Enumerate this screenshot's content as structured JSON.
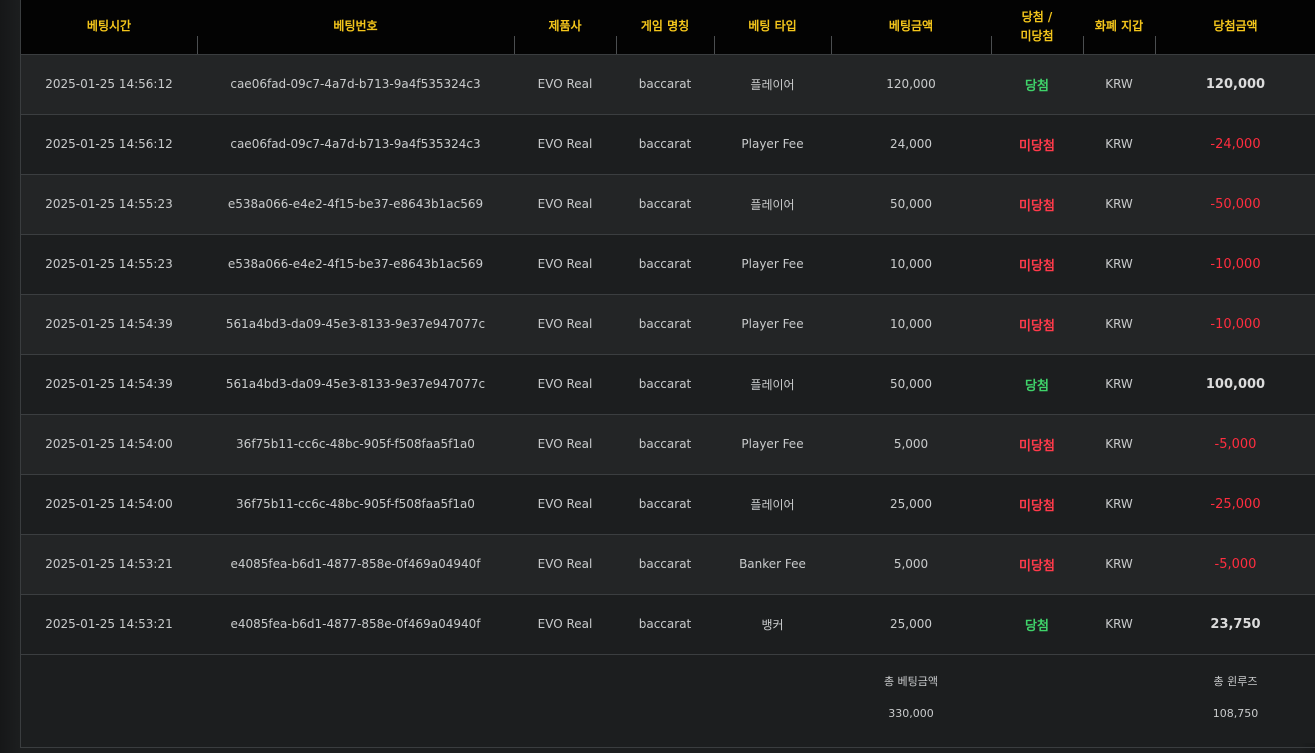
{
  "headers": {
    "bet_time": "베팅시간",
    "bet_id": "베팅번호",
    "provider": "제품사",
    "game_name": "게임 명칭",
    "bet_type": "베팅 타입",
    "bet_amount": "베팅금액",
    "result_line1": "당첨 /",
    "result_line2": "미당첨",
    "currency": "화폐 지갑",
    "win_amount": "당첨금액"
  },
  "rows": [
    {
      "time": "2025-01-25 14:56:12",
      "id": "cae06fad-09c7-4a7d-b713-9a4f535324c3",
      "provider": "EVO Real",
      "game": "baccarat",
      "type": "플레이어",
      "amount": "120,000",
      "result": "당첨",
      "currency": "KRW",
      "win": "120,000"
    },
    {
      "time": "2025-01-25 14:56:12",
      "id": "cae06fad-09c7-4a7d-b713-9a4f535324c3",
      "provider": "EVO Real",
      "game": "baccarat",
      "type": "Player Fee",
      "amount": "24,000",
      "result": "미당첨",
      "currency": "KRW",
      "win": "-24,000"
    },
    {
      "time": "2025-01-25 14:55:23",
      "id": "e538a066-e4e2-4f15-be37-e8643b1ac569",
      "provider": "EVO Real",
      "game": "baccarat",
      "type": "플레이어",
      "amount": "50,000",
      "result": "미당첨",
      "currency": "KRW",
      "win": "-50,000"
    },
    {
      "time": "2025-01-25 14:55:23",
      "id": "e538a066-e4e2-4f15-be37-e8643b1ac569",
      "provider": "EVO Real",
      "game": "baccarat",
      "type": "Player Fee",
      "amount": "10,000",
      "result": "미당첨",
      "currency": "KRW",
      "win": "-10,000"
    },
    {
      "time": "2025-01-25 14:54:39",
      "id": "561a4bd3-da09-45e3-8133-9e37e947077c",
      "provider": "EVO Real",
      "game": "baccarat",
      "type": "Player Fee",
      "amount": "10,000",
      "result": "미당첨",
      "currency": "KRW",
      "win": "-10,000"
    },
    {
      "time": "2025-01-25 14:54:39",
      "id": "561a4bd3-da09-45e3-8133-9e37e947077c",
      "provider": "EVO Real",
      "game": "baccarat",
      "type": "플레이어",
      "amount": "50,000",
      "result": "당첨",
      "currency": "KRW",
      "win": "100,000"
    },
    {
      "time": "2025-01-25 14:54:00",
      "id": "36f75b11-cc6c-48bc-905f-f508faa5f1a0",
      "provider": "EVO Real",
      "game": "baccarat",
      "type": "Player Fee",
      "amount": "5,000",
      "result": "미당첨",
      "currency": "KRW",
      "win": "-5,000"
    },
    {
      "time": "2025-01-25 14:54:00",
      "id": "36f75b11-cc6c-48bc-905f-f508faa5f1a0",
      "provider": "EVO Real",
      "game": "baccarat",
      "type": "플레이어",
      "amount": "25,000",
      "result": "미당첨",
      "currency": "KRW",
      "win": "-25,000"
    },
    {
      "time": "2025-01-25 14:53:21",
      "id": "e4085fea-b6d1-4877-858e-0f469a04940f",
      "provider": "EVO Real",
      "game": "baccarat",
      "type": "Banker Fee",
      "amount": "5,000",
      "result": "미당첨",
      "currency": "KRW",
      "win": "-5,000"
    },
    {
      "time": "2025-01-25 14:53:21",
      "id": "e4085fea-b6d1-4877-858e-0f469a04940f",
      "provider": "EVO Real",
      "game": "baccarat",
      "type": "뱅커",
      "amount": "25,000",
      "result": "당첨",
      "currency": "KRW",
      "win": "23,750"
    }
  ],
  "totals": {
    "bet_label": "총 베팅금액",
    "bet_value": "330,000",
    "winloss_label": "총 윈루즈",
    "winloss_value": "108,750"
  },
  "colors": {
    "header_text": "#f3c51b",
    "win": "#3fd26a",
    "lose": "#ff3a4a",
    "negative_amount": "#ff2d3f"
  }
}
